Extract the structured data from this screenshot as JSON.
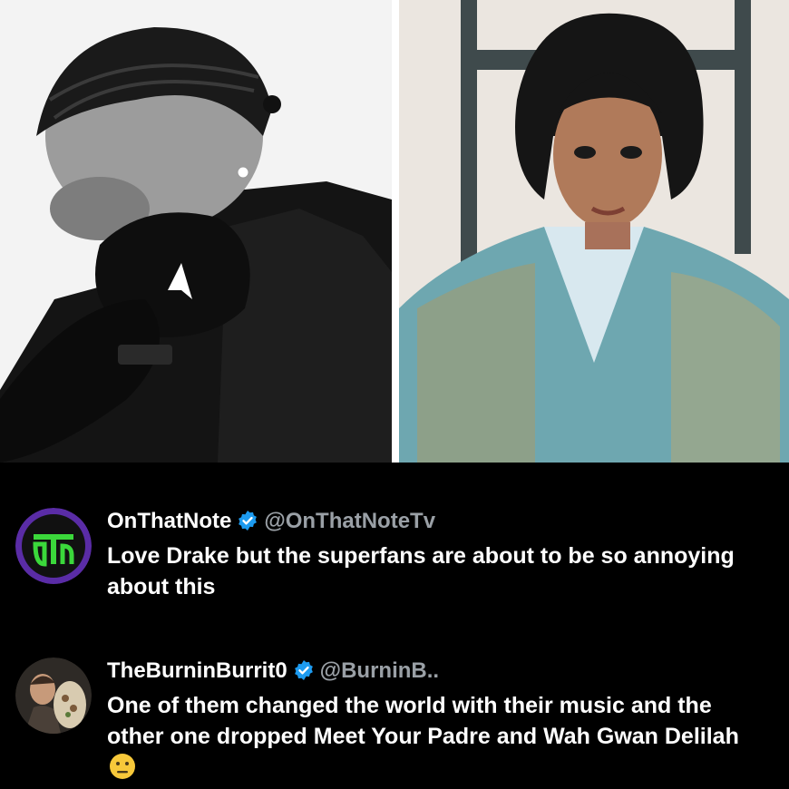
{
  "images": {
    "left_photo": "portrait-left",
    "right_photo": "portrait-right"
  },
  "tweets": [
    {
      "display_name": "OnThatNote",
      "handle": "@OnThatNoteTv",
      "text": "Love Drake but the superfans are about to be so annoying about this",
      "verified": true,
      "avatar": "onthatnote-logo",
      "avatar_color": "#3bd83b"
    },
    {
      "display_name": "TheBurninBurrit0",
      "handle": "@BurninB..",
      "text": "One of them changed the world with their music and the other one dropped Meet Your Padre and Wah Gwan Delilah",
      "verified": true,
      "avatar": "burrito-avatar",
      "emoji": "neutral-face-emoji"
    }
  ],
  "colors": {
    "background": "#000000",
    "verified_badge": "#1d9bf0",
    "handle": "#9aa0a6"
  }
}
